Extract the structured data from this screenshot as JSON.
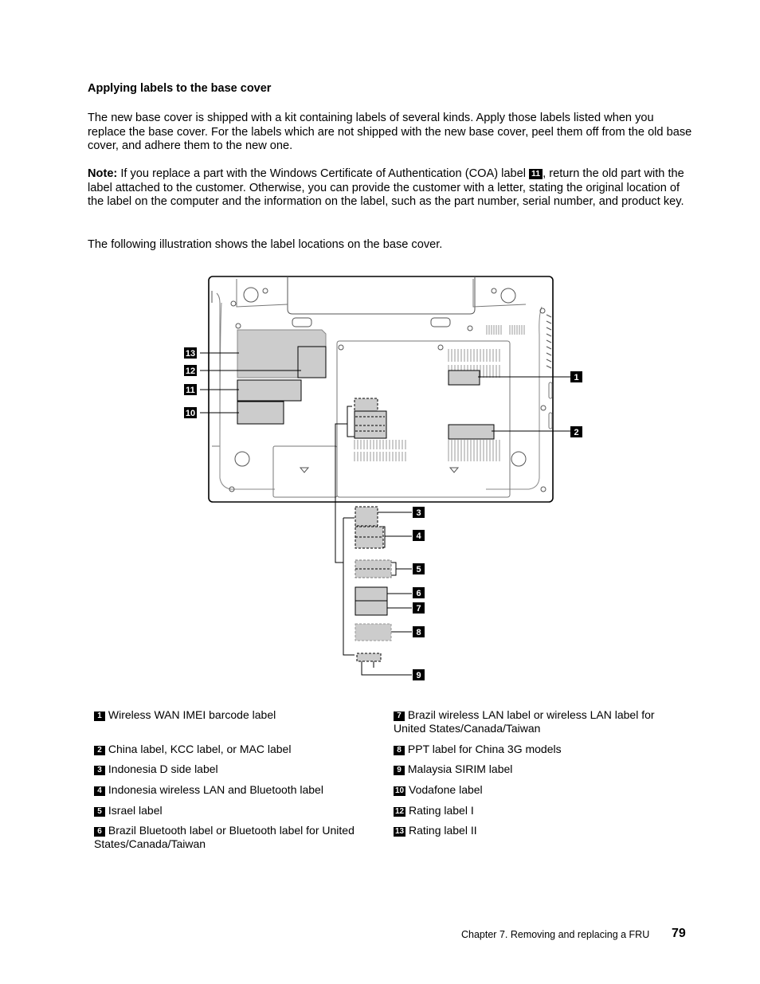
{
  "heading": "Applying labels to the base cover",
  "intro": "The new base cover is shipped with a kit containing labels of several kinds. Apply those labels listed when you replace the base cover. For the labels which are not shipped with the new base cover, peel them off from the old base cover, and adhere them to the new one.",
  "note": {
    "label": "Note:",
    "text_before": " If you replace a part with the Windows Certificate of Authentication (COA) label ",
    "badge": "11",
    "text_after": ", return the old part with the label attached to the customer. Otherwise, you can provide the customer with a letter, stating the original location of the label on the computer and the information on the label, such as the part number, serial number, and product key."
  },
  "illustration_intro": "The following illustration shows the label locations on the base cover.",
  "figure": {
    "callouts": [
      "1",
      "2",
      "3",
      "4",
      "5",
      "6",
      "7",
      "8",
      "9",
      "10",
      "11",
      "12",
      "13"
    ],
    "label_fill": "#cccccc"
  },
  "legend": [
    {
      "num": "1",
      "text": "Wireless WAN IMEI barcode label"
    },
    {
      "num": "2",
      "text": "China label, KCC label, or MAC label"
    },
    {
      "num": "3",
      "text": "Indonesia D side label"
    },
    {
      "num": "4",
      "text": "Indonesia wireless LAN and Bluetooth label"
    },
    {
      "num": "5",
      "text": "Israel label"
    },
    {
      "num": "6",
      "text": "Brazil Bluetooth label or Bluetooth label for United States/Canada/Taiwan"
    },
    {
      "num": "7",
      "text": "Brazil wireless LAN label or wireless LAN label for United States/Canada/Taiwan"
    },
    {
      "num": "8",
      "text": "PPT label for China 3G models"
    },
    {
      "num": "9",
      "text": "Malaysia SIRIM label"
    },
    {
      "num": "10",
      "text": "Vodafone label"
    },
    {
      "num": "12",
      "text": "Rating label I"
    },
    {
      "num": "13",
      "text": "Rating label II"
    }
  ],
  "footer": {
    "chapter": "Chapter 7. Removing and replacing a FRU",
    "page": "79"
  }
}
